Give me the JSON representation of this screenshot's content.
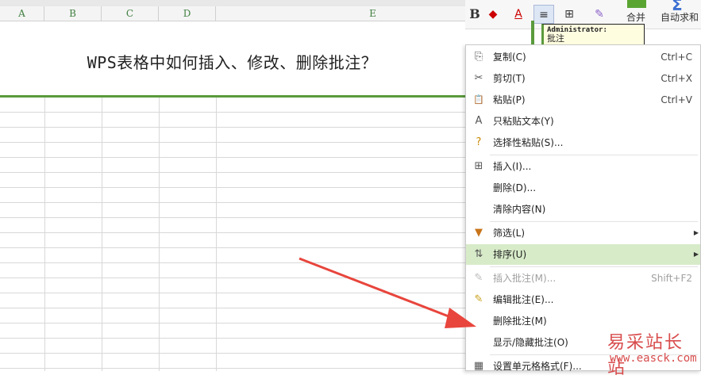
{
  "columns": [
    "A",
    "B",
    "C",
    "D",
    "E"
  ],
  "sheet": {
    "title_text": "WPS表格中如何插入、修改、删除批注？"
  },
  "ribbon": {
    "bold_label": "B",
    "merge_label": "合并",
    "autosum_label": "自动求和",
    "accent_color": "#5aa532"
  },
  "comment": {
    "author": "Administrator:",
    "body": "批注"
  },
  "context_menu": {
    "items": [
      {
        "icon": "copy-icon",
        "glyph": "⎘",
        "label": "复制(C)",
        "shortcut": "Ctrl+C"
      },
      {
        "icon": "cut-icon",
        "glyph": "✂",
        "label": "剪切(T)",
        "shortcut": "Ctrl+X"
      },
      {
        "icon": "paste-icon",
        "glyph": "📋",
        "label": "粘贴(P)",
        "shortcut": "Ctrl+V"
      },
      {
        "icon": "paste-text-icon",
        "glyph": "A",
        "label": "只粘贴文本(Y)",
        "shortcut": ""
      },
      {
        "icon": "paste-special-icon",
        "glyph": "?",
        "label": "选择性粘贴(S)...",
        "shortcut": ""
      },
      {
        "icon": "insert-icon",
        "glyph": "⊞",
        "label": "插入(I)...",
        "shortcut": ""
      },
      {
        "icon": "",
        "glyph": "",
        "label": "删除(D)...",
        "shortcut": ""
      },
      {
        "icon": "",
        "glyph": "",
        "label": "清除内容(N)",
        "shortcut": ""
      },
      {
        "icon": "filter-icon",
        "glyph": "▼",
        "label": "筛选(L)",
        "shortcut": ""
      },
      {
        "icon": "sort-icon",
        "glyph": "⇅",
        "label": "排序(U)",
        "shortcut": ""
      },
      {
        "icon": "insert-comment-icon",
        "glyph": "✎",
        "label": "插入批注(M)...",
        "shortcut": "Shift+F2"
      },
      {
        "icon": "edit-comment-icon",
        "glyph": "✎",
        "label": "编辑批注(E)...",
        "shortcut": ""
      },
      {
        "icon": "",
        "glyph": "",
        "label": "删除批注(M)",
        "shortcut": ""
      },
      {
        "icon": "",
        "glyph": "",
        "label": "显示/隐藏批注(O)",
        "shortcut": ""
      },
      {
        "icon": "format-cells-icon",
        "glyph": "▦",
        "label": "设置单元格格式(F)...",
        "shortcut": ""
      }
    ],
    "highlight_color": "#d7ebc9"
  },
  "annotation_arrow_color": "#e8453c",
  "watermark": {
    "cn": "易采站长站",
    "url": "www.easck.com"
  }
}
